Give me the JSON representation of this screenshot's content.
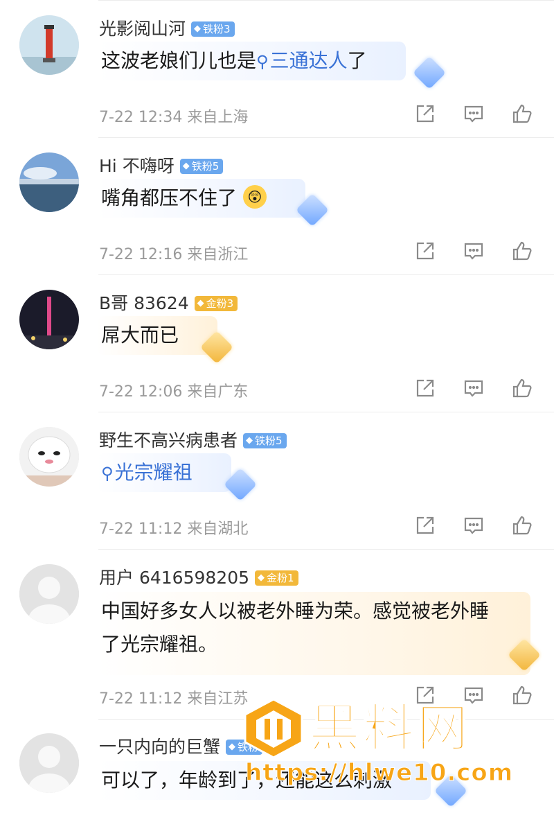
{
  "comments": [
    {
      "username": "光影阅山河",
      "badge": "铁粉3",
      "text_prefix": "这波老娘们儿也是",
      "topic": "三通达人",
      "text_suffix": "了",
      "meta": "7-22 12:34 来自上海"
    },
    {
      "username": "Hi 不嗨呀",
      "badge": "铁粉5",
      "text": "嘴角都压不住了",
      "emoji": "😲",
      "meta": "7-22 12:16 来自浙江"
    },
    {
      "username": "B哥 83624",
      "badge": "金粉3",
      "text": "屌大而已",
      "meta": "7-22 12:06 来自广东"
    },
    {
      "username": "野生不高兴病患者",
      "badge": "铁粉5",
      "topic": "光宗耀祖",
      "meta": "7-22 11:12 来自湖北"
    },
    {
      "username": "用户 6416598205",
      "badge": "金粉1",
      "text": "中国好多女人以被老外睡为荣。感觉被老外睡了光宗耀祖。",
      "meta": "7-22 11:12 来自江苏"
    },
    {
      "username": "一只内向的巨蟹",
      "badge": "铁粉",
      "text": "可以了，年龄到了，还能这么刺激"
    }
  ],
  "watermark": {
    "title": "黑料网",
    "url": "https://hlwe10.com"
  },
  "icons": [
    "share-icon",
    "comment-icon",
    "like-icon",
    "search-icon",
    "diamond-icon"
  ],
  "colors": {
    "link": "#3a72d6",
    "iron_badge": "#6aa7ee",
    "gold_badge": "#f2b83a",
    "watermark": "#f7a516"
  }
}
